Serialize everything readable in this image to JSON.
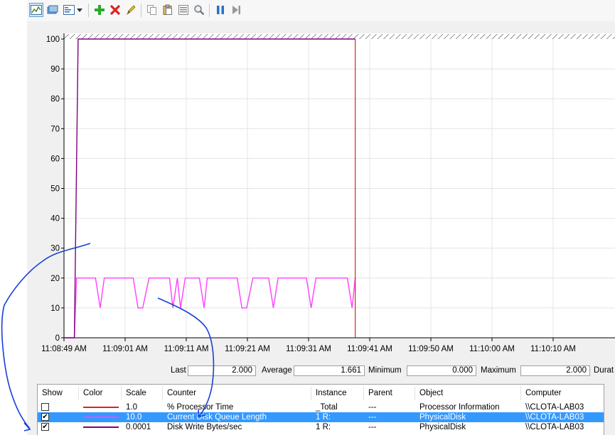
{
  "toolbar": {
    "icons": [
      "view-graph-icon",
      "view-histogram-icon",
      "view-report-icon",
      "dropdown-arrow-icon",
      "add-counter-icon",
      "delete-counter-icon",
      "highlight-icon",
      "copy-properties-icon",
      "paste-counter-list-icon",
      "properties-icon",
      "zoom-icon",
      "freeze-display-icon",
      "update-data-icon"
    ]
  },
  "colors": {
    "processor": "#e02020",
    "disk_queue": "#ff40ff",
    "disk_write": "#800080",
    "selection": "#3399ff",
    "annotation": "#1a3fd6"
  },
  "chart_data": {
    "type": "line",
    "ylim": [
      0,
      100
    ],
    "yticks": [
      "0",
      "10",
      "20",
      "30",
      "40",
      "50",
      "60",
      "70",
      "80",
      "90",
      "100"
    ],
    "xticks": [
      "11:08:49 AM",
      "11:09:01 AM",
      "11:09:11 AM",
      "11:09:21 AM",
      "11:09:31 AM",
      "11:09:41 AM",
      "11:09:50 AM",
      "11:10:00 AM",
      "11:10:10 AM"
    ],
    "grid": true,
    "series": [
      {
        "name": "Current Disk Queue Length",
        "color_key": "disk_queue",
        "x": [
          0,
          3.3,
          4,
          10,
          11.5,
          12.8,
          15,
          22,
          23.5,
          25,
          27,
          33.5,
          34.6,
          36,
          37,
          38.5,
          40,
          43,
          44.5,
          45.5,
          47,
          49,
          55,
          56.5,
          58,
          60,
          65,
          66.5,
          68,
          70,
          75,
          77,
          78.5,
          80,
          82,
          90,
          91.5,
          92.5
        ],
        "y": [
          0,
          0,
          20,
          20,
          10,
          20,
          20,
          20,
          10,
          10,
          20,
          20,
          10,
          20,
          10,
          20,
          20,
          20,
          10,
          20,
          20,
          20,
          20,
          10,
          10,
          20,
          20,
          10,
          20,
          20,
          20,
          20,
          10,
          20,
          20,
          20,
          10,
          20
        ]
      },
      {
        "name": "Disk Write Bytes/sec",
        "color_key": "disk_write",
        "x": [
          0,
          3.3,
          4.5,
          92.5
        ],
        "y": [
          0,
          0,
          100,
          100
        ]
      }
    ],
    "cursor_x": 92.5,
    "x_domain": [
      0,
      175
    ]
  },
  "stats": {
    "last_label": "Last",
    "last_value": "2.000",
    "average_label": "Average",
    "average_value": "1.661",
    "minimum_label": "Minimum",
    "minimum_value": "0.000",
    "maximum_label": "Maximum",
    "maximum_value": "2.000",
    "duration_label": "Durat"
  },
  "table": {
    "headers": [
      "Show",
      "Color",
      "Scale",
      "Counter",
      "Instance",
      "Parent",
      "Object",
      "Computer"
    ],
    "rows": [
      {
        "checked": false,
        "color_key": "processor",
        "scale": "1.0",
        "counter": "% Processor Time",
        "instance": "_Total",
        "parent": "---",
        "object": "Processor Information",
        "computer": "\\\\CLOTA-LAB03",
        "selected": false
      },
      {
        "checked": true,
        "color_key": "disk_queue",
        "scale": "10.0",
        "counter": "Current Disk Queue Length",
        "instance": "1 R:",
        "parent": "---",
        "object": "PhysicalDisk",
        "computer": "\\\\CLOTA-LAB03",
        "selected": true
      },
      {
        "checked": true,
        "color_key": "disk_write",
        "scale": "0.0001",
        "counter": "Disk Write Bytes/sec",
        "instance": "1 R:",
        "parent": "---",
        "object": "PhysicalDisk",
        "computer": "\\\\CLOTA-LAB03",
        "selected": false
      }
    ]
  }
}
